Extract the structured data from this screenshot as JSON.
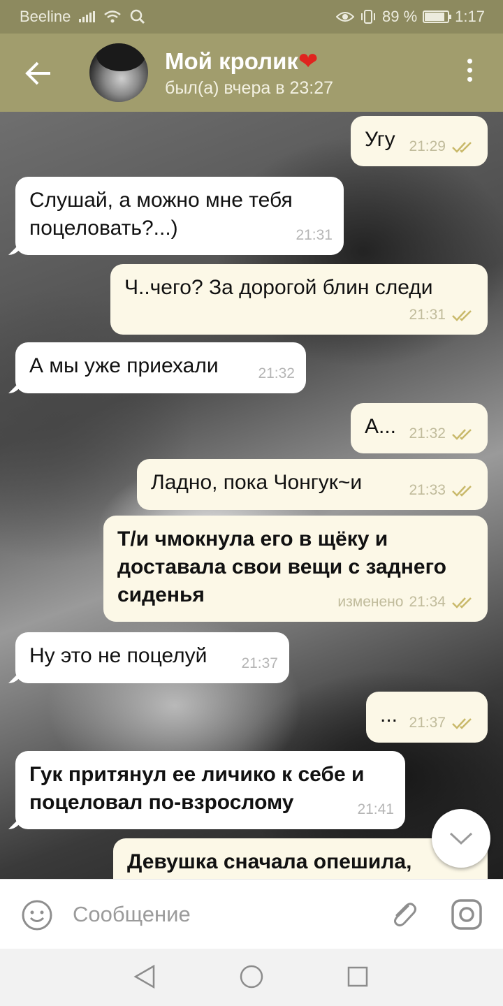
{
  "status_bar": {
    "carrier": "Beeline",
    "battery_percent_text": "89 %",
    "battery_level": 0.89,
    "time": "1:17"
  },
  "header": {
    "contact_name": "Мой кролик",
    "heart": "❤",
    "last_seen": "был(а) вчера в 23:27"
  },
  "messages": [
    {
      "dir": "out",
      "lines": [
        "Угу"
      ],
      "time": "21:29",
      "read": true
    },
    {
      "dir": "in",
      "lines": [
        "Слушай, а можно мне тебя",
        "поцеловать?...)"
      ],
      "time": "21:31"
    },
    {
      "dir": "out",
      "lines": [
        "Ч..чего? За дорогой блин следи"
      ],
      "time": "21:31",
      "read": true
    },
    {
      "dir": "in",
      "lines": [
        "А мы уже приехали"
      ],
      "time": "21:32"
    },
    {
      "dir": "out",
      "lines": [
        "А..."
      ],
      "time": "21:32",
      "read": true
    },
    {
      "dir": "out",
      "lines": [
        "Ладно, пока Чонгук~и"
      ],
      "time": "21:33",
      "read": true
    },
    {
      "dir": "out",
      "bold": true,
      "lines": [
        "Т/и чмокнула его в щёку и",
        "доставала свои вещи с заднего",
        "сиденья"
      ],
      "edited": "изменено",
      "time": "21:34",
      "read": true
    },
    {
      "dir": "in",
      "lines": [
        "Ну это не поцелуй"
      ],
      "time": "21:37"
    },
    {
      "dir": "out",
      "lines": [
        "..."
      ],
      "time": "21:37",
      "read": true
    },
    {
      "dir": "in",
      "bold": true,
      "lines": [
        "Гук притянул ее личико к себе и",
        "поцеловал по-взрослому"
      ],
      "time": "21:41"
    },
    {
      "dir": "out",
      "bold": true,
      "lines": [
        "Девушка сначала опешила,"
      ],
      "time": ""
    }
  ],
  "input": {
    "placeholder": "Сообщение"
  },
  "colors": {
    "header_bg": "#a19d6d",
    "status_bg": "#8d8a5f",
    "outgoing_bubble": "#fcf8e7",
    "incoming_bubble": "#ffffff",
    "read_check": "#c9b96a"
  }
}
